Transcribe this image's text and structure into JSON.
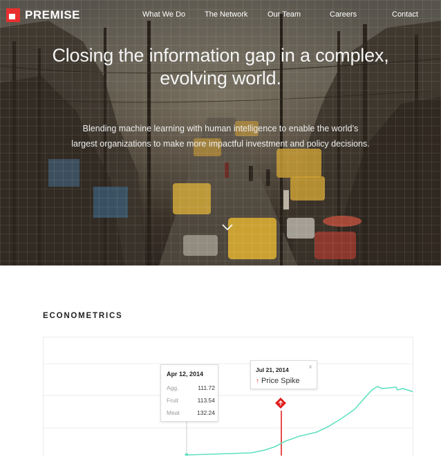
{
  "brand": {
    "name": "PREMISE",
    "accent_color": "#e8302f"
  },
  "nav": {
    "items": [
      {
        "label": "What We Do"
      },
      {
        "label": "The Network"
      },
      {
        "label": "Our Team"
      },
      {
        "label": "Careers"
      },
      {
        "label": "Contact"
      }
    ]
  },
  "hero": {
    "title_line1": "Closing the information gap in a complex,",
    "title_line2": "evolving world.",
    "subtitle_line1": "Blending machine learning with human intelligence to enable the world’s",
    "subtitle_line2": "largest organizations to make more impactful investment and policy decisions.",
    "scroll_icon": "chevron-down-icon"
  },
  "econometrics": {
    "title": "ECONOMETRICS",
    "line_color": "#5fe0c0",
    "spike_color": "#e0201f",
    "date_tooltip": {
      "date": "Apr 12, 2014",
      "rows": [
        {
          "label": "Agg.",
          "value": "111.72"
        },
        {
          "label": "Fruit",
          "value": "113.54"
        },
        {
          "label": "Meat",
          "value": "132.24"
        }
      ]
    },
    "event_tooltip": {
      "date": "Jul 21, 2014",
      "label": "Price Spike",
      "close_symbol": "×",
      "arrow_symbol": "↑"
    }
  }
}
